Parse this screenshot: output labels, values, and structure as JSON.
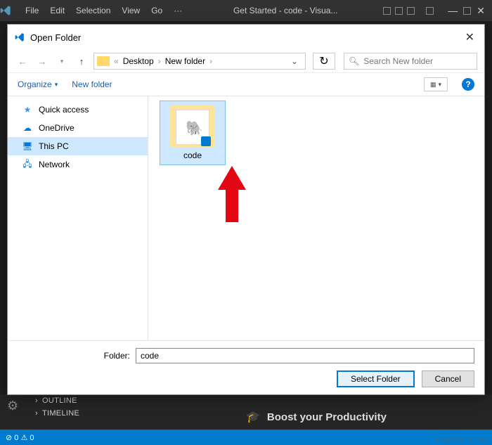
{
  "titlebar": {
    "menus": [
      "File",
      "Edit",
      "Selection",
      "View",
      "Go",
      "···"
    ],
    "title": "Get Started - code - Visua..."
  },
  "dialog": {
    "title": "Open Folder",
    "breadcrumb": {
      "prefix": "«",
      "parts": [
        "Desktop",
        "New folder"
      ]
    },
    "search_placeholder": "Search New folder",
    "toolbar": {
      "organize": "Organize",
      "newfolder": "New folder"
    },
    "nav": [
      {
        "label": "Quick access",
        "icon": "star"
      },
      {
        "label": "OneDrive",
        "icon": "cloud"
      },
      {
        "label": "This PC",
        "icon": "pc",
        "selected": true
      },
      {
        "label": "Network",
        "icon": "network"
      }
    ],
    "content": {
      "folder_name": "code"
    },
    "footer": {
      "label": "Folder:",
      "value": "code",
      "select": "Select Folder",
      "cancel": "Cancel"
    }
  },
  "panels": {
    "outline": "OUTLINE",
    "timeline": "TIMELINE"
  },
  "productivity": "Boost your Productivity",
  "statusbar": {
    "left": "⊘ 0 ⚠ 0"
  },
  "watermark": "www.devsjg.com"
}
